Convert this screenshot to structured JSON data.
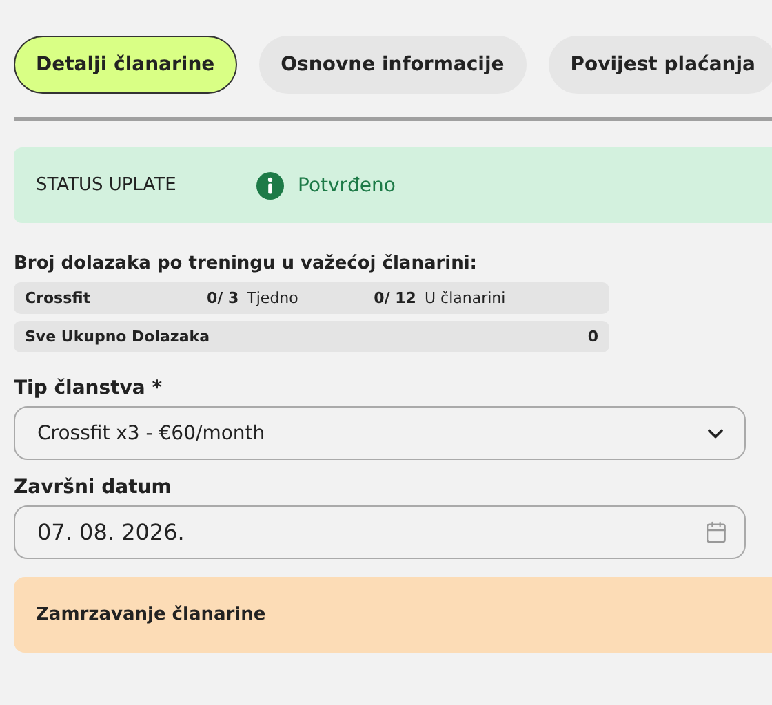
{
  "tabs": [
    {
      "label": "Detalji članarine",
      "selected": true
    },
    {
      "label": "Osnovne informacije",
      "selected": false
    },
    {
      "label": "Povijest plaćanja",
      "selected": false
    }
  ],
  "payment_status": {
    "label": "STATUS UPLATE",
    "value": "Potvrđeno"
  },
  "attendance": {
    "title": "Broj dolazaka po treningu u važećoj članarini:",
    "rows": [
      {
        "kind": "split",
        "name": "Crossfit",
        "week_count": "0/ 3",
        "week_label": "Tjedno",
        "total_count": "0/ 12",
        "total_label": "U članarini"
      },
      {
        "kind": "total",
        "name": "Sve Ukupno Dolazaka",
        "value": "0"
      }
    ]
  },
  "membership_type": {
    "label": "Tip članstva *",
    "value": "Crossfit x3 - €60/month"
  },
  "end_date": {
    "label": "Završni datum",
    "value": "07. 08. 2026."
  },
  "freeze_panel": {
    "title": "Zamrzavanje članarine"
  }
}
